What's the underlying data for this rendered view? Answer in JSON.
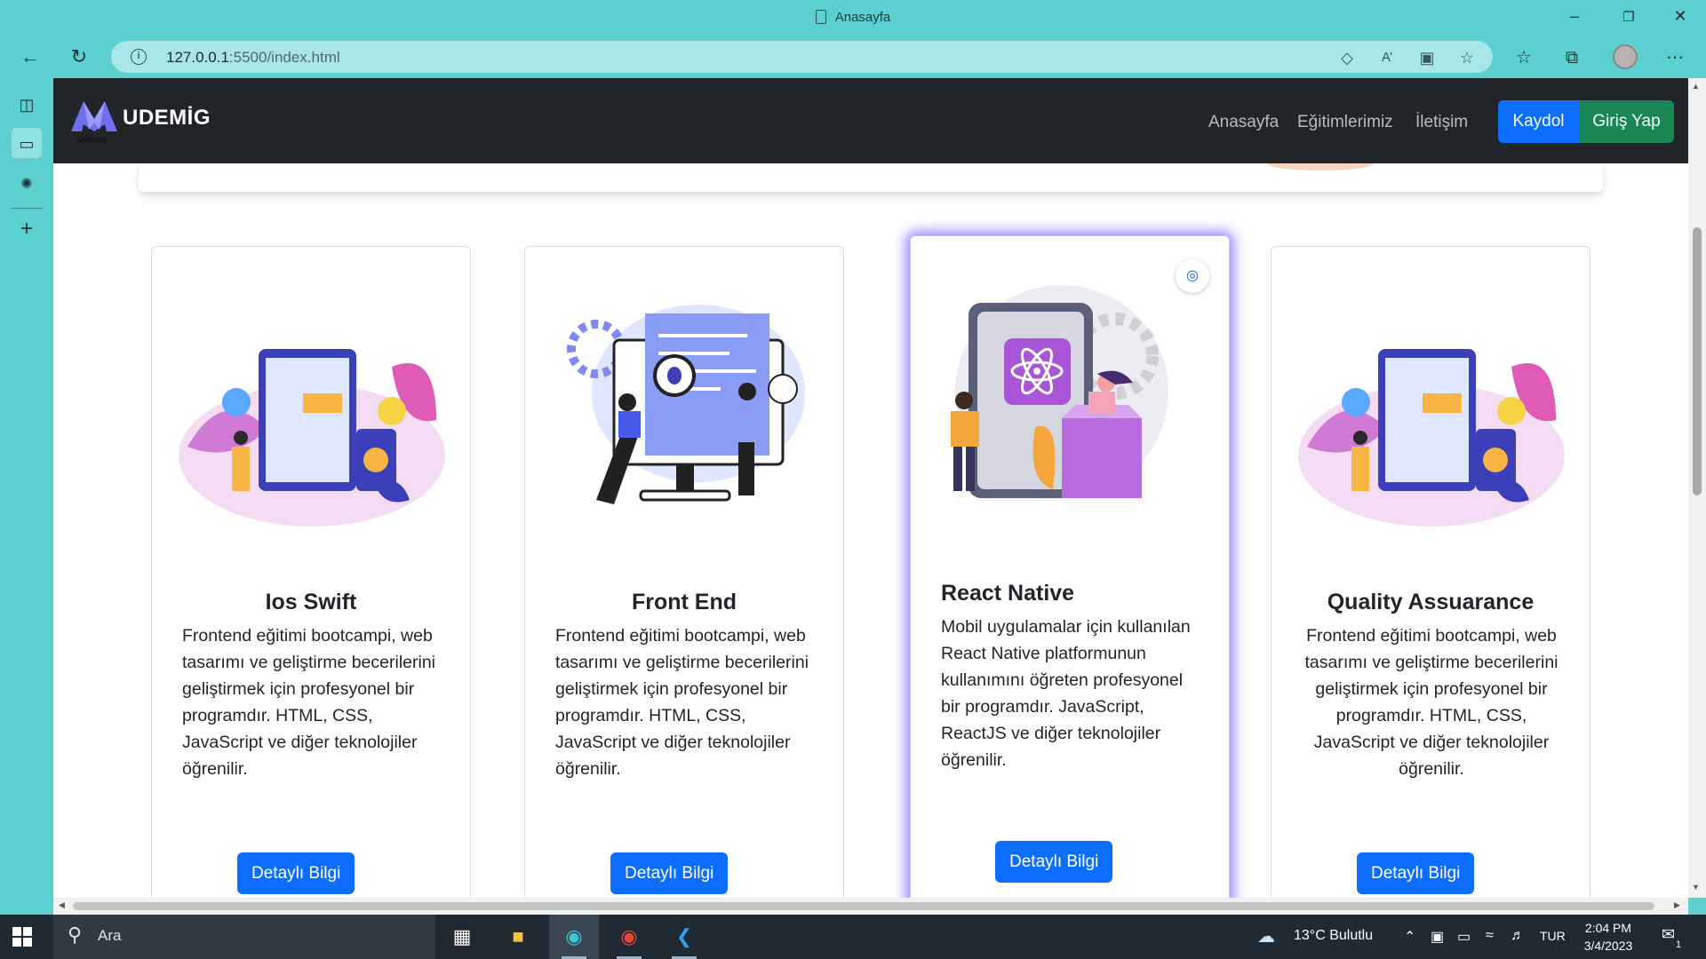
{
  "window": {
    "title": "Anasayfa",
    "minimize_icon": "minimize-icon",
    "maximize_icon": "restore-icon",
    "close_icon": "close-icon"
  },
  "addressbar": {
    "url_host": "127.0.0.1",
    "url_path": ":5500/index.html"
  },
  "site": {
    "brand": "UDEMİG",
    "brand_small": "Udemig",
    "nav": [
      "Anasayfa",
      "Eğitimlerimiz",
      "İletişim"
    ],
    "register": "Kaydol",
    "login": "Giriş Yap",
    "colors": {
      "navbar": "#212529",
      "primary": "#0d6efd",
      "success": "#198754"
    }
  },
  "cards": [
    {
      "title": "Ios Swift",
      "text": "Frontend eğitimi bootcampi, web tasarımı ve geliştirme becerilerini geliştirmek için profesyonel bir programdır. HTML, CSS, JavaScript ve diğer teknolojiler öğrenilir.",
      "button": "Detaylı Bilgi"
    },
    {
      "title": "Front End",
      "text": "Frontend eğitimi bootcampi, web tasarımı ve geliştirme becerilerini geliştirmek için profesyonel bir programdır. HTML, CSS, JavaScript ve diğer teknolojiler öğrenilir.",
      "button": "Detaylı Bilgi"
    },
    {
      "title": "React Native",
      "text": "Mobil uygulamalar için kullanılan React Native platformunun kullanımını öğreten profesyonel bir programdır. JavaScript, ReactJS ve diğer teknolojiler öğrenilir.",
      "button": "Detaylı Bilgi"
    },
    {
      "title": "Quality Assuarance",
      "text": "Frontend eğitimi bootcampi, web tasarımı ve geliştirme becerilerini geliştirmek için profesyonel bir programdır. HTML, CSS, JavaScript ve diğer teknolojiler öğrenilir.",
      "button": "Detaylı Bilgi"
    }
  ],
  "taskbar": {
    "search_placeholder": "Ara",
    "weather": "13°C  Bulutlu",
    "language": "TUR",
    "time": "2:04 PM",
    "date": "3/4/2023",
    "notifications": "1"
  }
}
